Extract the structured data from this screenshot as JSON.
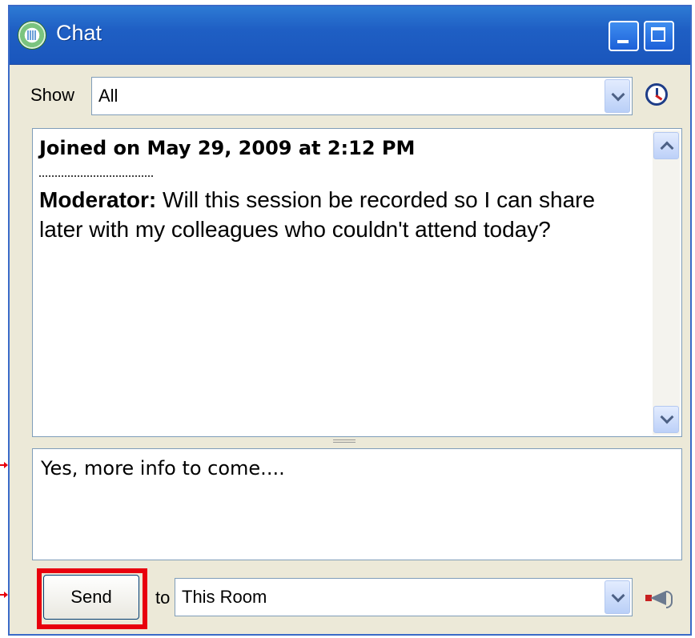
{
  "window": {
    "title": "Chat"
  },
  "filter": {
    "label": "Show",
    "selected": "All"
  },
  "transcript": {
    "joined_text": "Joined on May 29, 2009 at 2:12 PM",
    "messages": [
      {
        "sender": "Moderator:",
        "text": " Will this session be recorded so I can share later with my colleagues who couldn't attend today?"
      }
    ]
  },
  "compose": {
    "value": "Yes, more info to come...."
  },
  "send": {
    "button_label": "Send",
    "to_label": "to",
    "recipient": "This Room"
  },
  "icons": {
    "app": "chat-app-icon",
    "history": "clock-icon",
    "megaphone": "megaphone-icon"
  },
  "colors": {
    "titlebar": "#1f5fc4",
    "highlight": "#e8000d"
  }
}
